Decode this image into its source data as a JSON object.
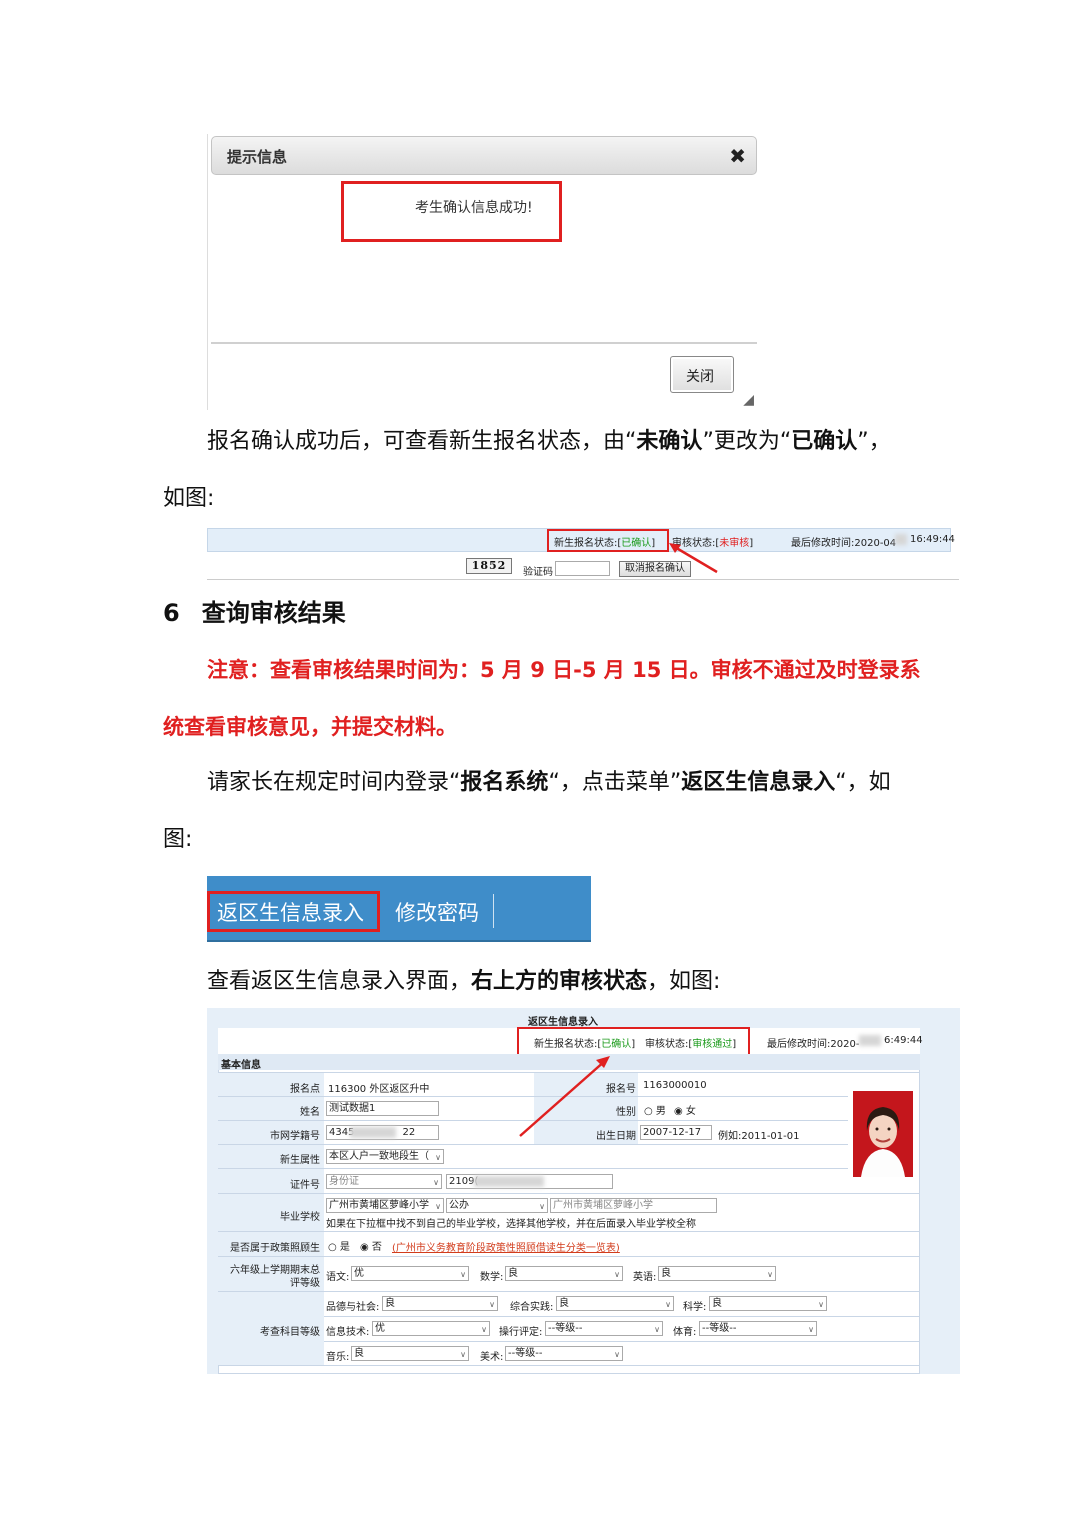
{
  "dialog": {
    "title": "提示信息",
    "message": "考生确认信息成功!",
    "close_label": "关闭"
  },
  "para1": {
    "part1": "报名确认成功后，可查看新生报名状态，由",
    "q1": "“",
    "bold1": "未确认",
    "q2": "”",
    "part2": "更改为",
    "q3": "“",
    "bold2": "已确认",
    "q4": "”",
    "tail": "，",
    "line2": "如图:"
  },
  "status_bar": {
    "reg_label": "新生报名状态:[",
    "reg_value": "已确认",
    "reg_close": "]",
    "audit_label": "审核状态:[",
    "audit_value": "未审核",
    "audit_close": "]",
    "modified_a": "最后修改时间:2020-04",
    "modified_b": "16:49:44",
    "captcha_code": "1852",
    "captcha_label": "验证码",
    "cancel_button": "取消报名确认"
  },
  "section6": {
    "number": "6",
    "title": "查询审核结果"
  },
  "notice": {
    "line1": "注意：查看审核结果时间为：5 月 9 日-5 月 15 日。审核不通过及时登录系",
    "line2": "统查看审核意见，并提交材料。"
  },
  "para2": {
    "part1": "请家长在规定时间内登录",
    "q1": "“",
    "bold1": "报名系统",
    "q2": "“，点击菜单”",
    "bold2": "返区生信息录入",
    "q3": "“，如",
    "line2": "图:"
  },
  "menu": {
    "item1": "返区生信息录入",
    "item2": "修改密码"
  },
  "para3": {
    "part1": "查看返区生信息录入界面，",
    "bold1": "右上方的审核状态",
    "part2": "，如图:"
  },
  "form": {
    "title": "返区生信息录入",
    "reg_label": "新生报名状态:[",
    "reg_value": "已确认",
    "reg_close": "]",
    "audit_label": "审核状态:[",
    "audit_value": "审核通过",
    "audit_close": "]",
    "modified_a": "最后修改时间:2020-",
    "modified_b": "6:49:44",
    "section": "基本信息",
    "baomingdian_label": "报名点",
    "baomingdian_value": "116300 外区返区升中",
    "baominghao_label": "报名号",
    "baominghao_value": "1163000010",
    "name_label": "姓名",
    "name_value": "测试数据1",
    "gender_label": "性别",
    "gender_male": "男",
    "gender_female": "女",
    "xueji_label": "市网学籍号",
    "xueji_a": "4345",
    "xueji_b": "22",
    "birth_label": "出生日期",
    "birth_value": "2007-12-17",
    "birth_example": "例如:2011-01-01",
    "attr_label": "新生属性",
    "attr_value": "本区人户一致地段生（",
    "id_label": "证件号",
    "id_type": "身份证",
    "id_value": "2109(",
    "school_label": "毕业学校",
    "school_sel1": "广州市黄埔区萝峰小学",
    "school_sel2": "公办",
    "school_input": "广州市黄埔区萝峰小学",
    "school_hint": "如果在下拉框中找不到自己的毕业学校，选择其他学校，并在后面录入毕业学校全称",
    "policy_label": "是否属于政策照顾生",
    "policy_yes": "是",
    "policy_no": "否",
    "policy_link": "(广州市义务教育阶段政策性照顾借读生分类一览表)",
    "grade_label_1": "六年级上学期期末总",
    "grade_label_2": "评等级",
    "yuwen_label": "语文:",
    "yuwen_value": "优",
    "shuxue_label": "数学:",
    "shuxue_value": "良",
    "yingyu_label": "英语:",
    "yingyu_value": "良",
    "exam_label": "考查科目等级",
    "pinde_label": "品德与社会:",
    "pinde_value": "良",
    "zonghe_label": "综合实践:",
    "zonghe_value": "良",
    "kexue_label": "科学:",
    "kexue_value": "良",
    "xinxi_label": "信息技术:",
    "xinxi_value": "优",
    "caoxing_label": "操行评定:",
    "caoxing_value": "--等级--",
    "tiyu_label": "体育:",
    "tiyu_value": "--等级--",
    "yinyue_label": "音乐:",
    "yinyue_value": "良",
    "meishu_label": "美术:",
    "meishu_value": "--等级--"
  }
}
